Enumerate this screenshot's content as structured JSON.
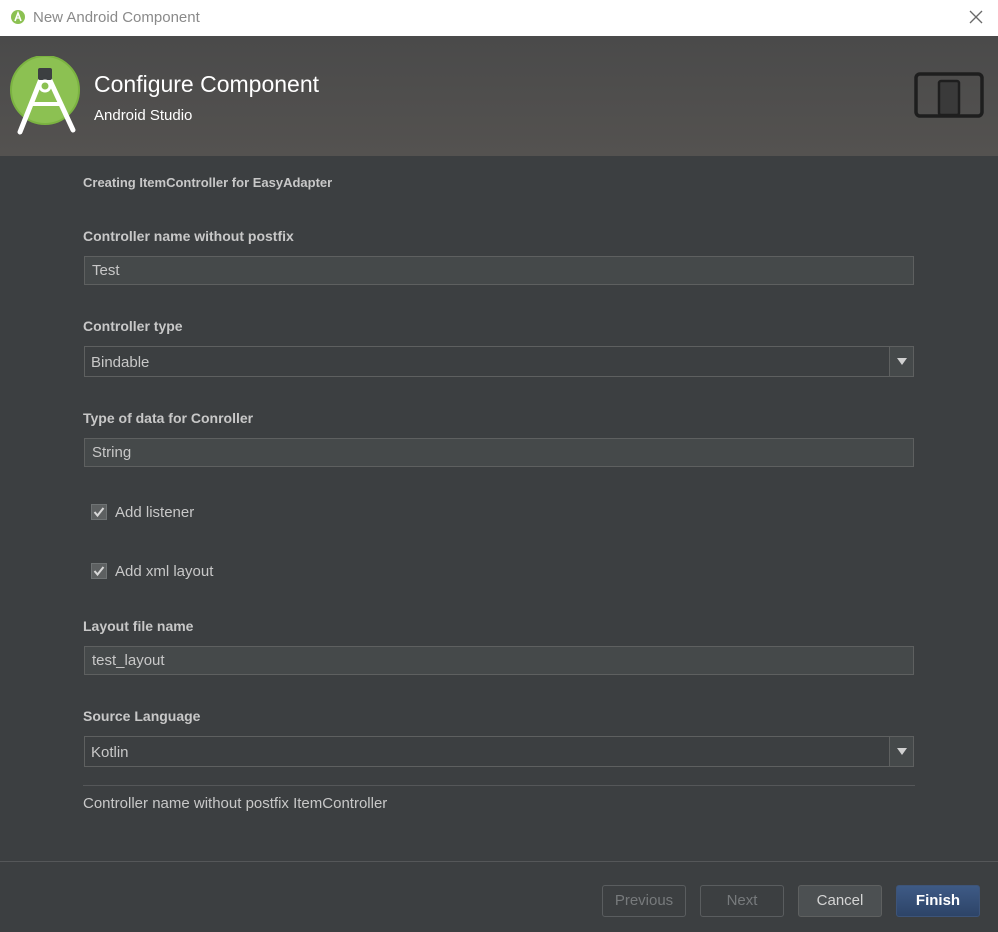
{
  "window": {
    "title": "New Android Component"
  },
  "header": {
    "title": "Configure Component",
    "subtitle": "Android Studio"
  },
  "form": {
    "description": "Creating ItemController for EasyAdapter",
    "controller_name": {
      "label": "Controller name without postfix",
      "value": "Test"
    },
    "controller_type": {
      "label": "Controller type",
      "value": "Bindable"
    },
    "data_type": {
      "label": "Type of data for Conroller",
      "value": "String"
    },
    "add_listener": {
      "label": "Add listener",
      "checked": true
    },
    "add_xml_layout": {
      "label": "Add xml layout",
      "checked": true
    },
    "layout_file_name": {
      "label": "Layout file name",
      "value": "test_layout"
    },
    "source_language": {
      "label": "Source Language",
      "value": "Kotlin"
    },
    "summary": "Controller name without postfix ItemController"
  },
  "buttons": {
    "previous": "Previous",
    "next": "Next",
    "cancel": "Cancel",
    "finish": "Finish"
  },
  "icons": {
    "app": "android-studio-icon",
    "close": "close-icon",
    "logo": "android-studio-logo",
    "device": "tablet-phone-icon",
    "dropdown": "chevron-down-icon",
    "check": "checkmark-icon"
  },
  "colors": {
    "background": "#3c3f41",
    "header": "#4e4d4c",
    "accent_green": "#8cc152",
    "default_button": "#365880",
    "text": "#c8c8c8"
  }
}
